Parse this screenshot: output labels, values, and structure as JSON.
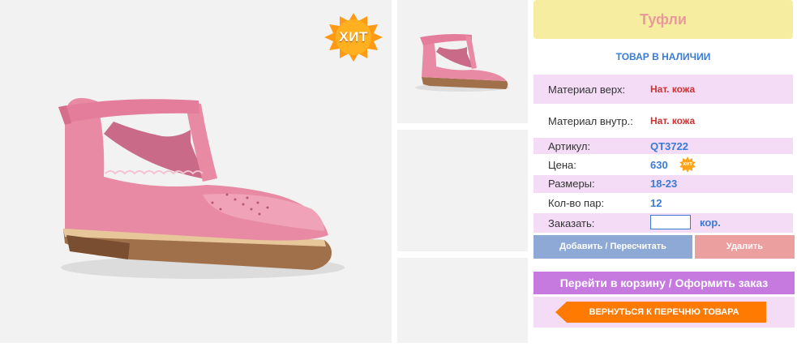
{
  "badge": {
    "hit_label": "ХИТ"
  },
  "product": {
    "title": "Туфли",
    "stock_status": "ТОВАР В НАЛИЧИИ"
  },
  "specs": {
    "material_top_label": "Материал верх:",
    "material_top_value": "Нат. кожа",
    "material_inner_label": "Материал внутр.:",
    "material_inner_value": "Нат. кожа",
    "article_label": "Артикул:",
    "article_value": "QT3722",
    "price_label": "Цена:",
    "price_value": "630",
    "price_badge": "хит",
    "sizes_label": "Размеры:",
    "sizes_value": "18-23",
    "pairs_label": "Кол-во пар:",
    "pairs_value": "12"
  },
  "order": {
    "label": "Заказать:",
    "input_value": "",
    "unit": "кор."
  },
  "actions": {
    "add_label": "Добавить / Пересчитать",
    "delete_label": "Удалить",
    "cart_label": "Перейти в корзину / Оформить заказ",
    "back_label": "ВЕРНУТЬСЯ К ПЕРЕЧНЮ ТОВАРА"
  },
  "colors": {
    "title_bg": "#f7eda0",
    "title_text": "#e89a9a",
    "row_pink": "#f4dcf7",
    "value_blue": "#3a7bd5",
    "value_red": "#cc3333",
    "add_button": "#8fa9d6",
    "delete_button": "#ec9f9f",
    "cart_button": "#c67ae0",
    "back_button": "#ff7a00",
    "shoe": "#e98aa5"
  }
}
